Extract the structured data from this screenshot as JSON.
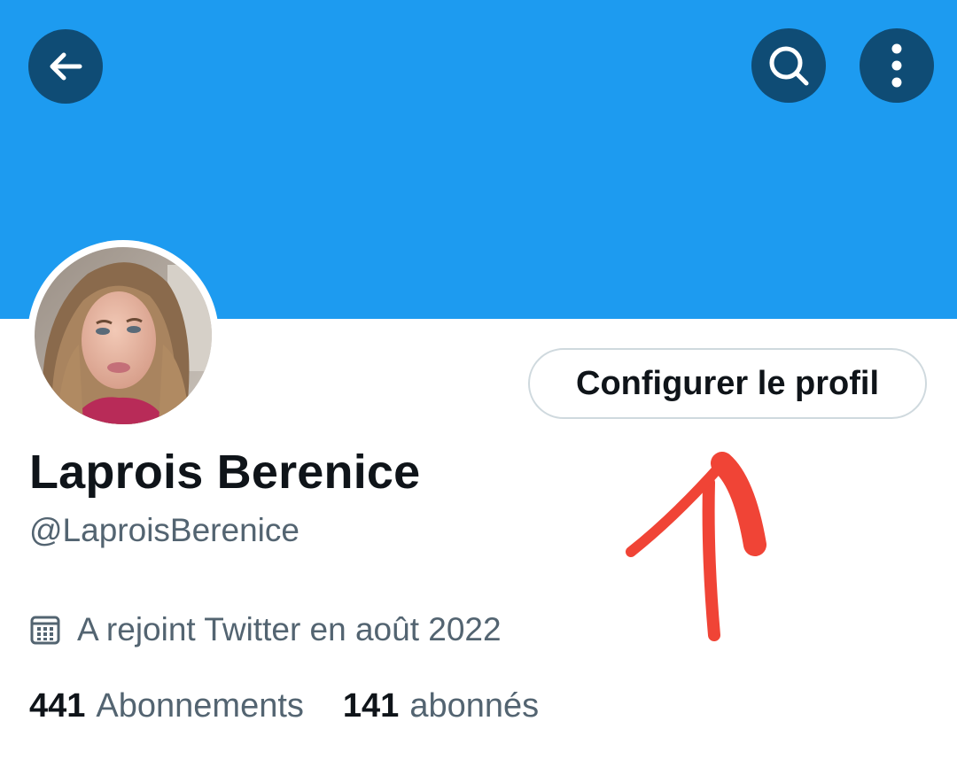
{
  "header": {
    "back_icon": "back-arrow-icon",
    "search_icon": "search-icon",
    "more_icon": "more-vertical-icon",
    "banner_color": "#1d9bf0",
    "button_color": "#0f4c75"
  },
  "profile": {
    "avatar_icon": "avatar",
    "edit_button_label": "Configurer le profil",
    "display_name": "Laprois Berenice",
    "handle": "@LaproisBerenice",
    "joined_icon": "calendar-icon",
    "joined_text": "A rejoint Twitter en août 2022",
    "following_count": "441",
    "following_label": "Abonnements",
    "followers_count": "141",
    "followers_label": "abonnés"
  },
  "annotation": {
    "arrow_color": "#f04436"
  }
}
